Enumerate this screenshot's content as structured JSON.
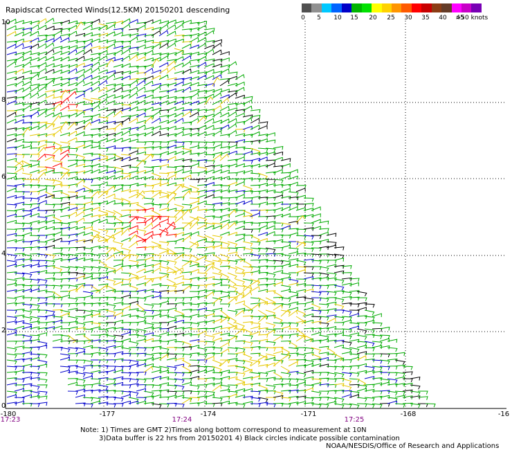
{
  "title": "Rapidscat Corrected Winds(12.5KM) 20150201 descending",
  "scale": {
    "colors": [
      "#505050",
      "#909090",
      "#00c8ff",
      "#0064ff",
      "#0000c8",
      "#00b400",
      "#00e100",
      "#ffff00",
      "#ffd200",
      "#ff9600",
      "#ff5a00",
      "#ff0000",
      "#c80000",
      "#8c3c14",
      "#643c28",
      "#ff00ff",
      "#c800c8",
      "#7800b4"
    ],
    "labels": [
      "0",
      "5",
      "10",
      "15",
      "20",
      "25",
      "30",
      "35",
      "40",
      "45",
      ">50 knots"
    ]
  },
  "axes": {
    "lat_labels": [
      "10",
      "8",
      "6",
      "4",
      "2",
      "0"
    ],
    "lon_labels": [
      "-180",
      "-177",
      "-174",
      "-171",
      "-168",
      "-16"
    ],
    "time_labels": [
      "17:23",
      "17:24",
      "17:25"
    ]
  },
  "notes": {
    "line1": "Note: 1) Times are GMT 2)Times along bottom correspond to measurement at 10N",
    "line2": "3)Data buffer is 22 hrs from 20150201 4) Black circles indicate possible contamination",
    "line3": "NOAA/NESDIS/Office of Research and Applications"
  },
  "colors": {
    "low": "#0000cc",
    "mid": "#00aa00",
    "high": "#e6c800",
    "peak": "#ff0000",
    "contaminated": "#000000",
    "time_label": "#800080"
  }
}
